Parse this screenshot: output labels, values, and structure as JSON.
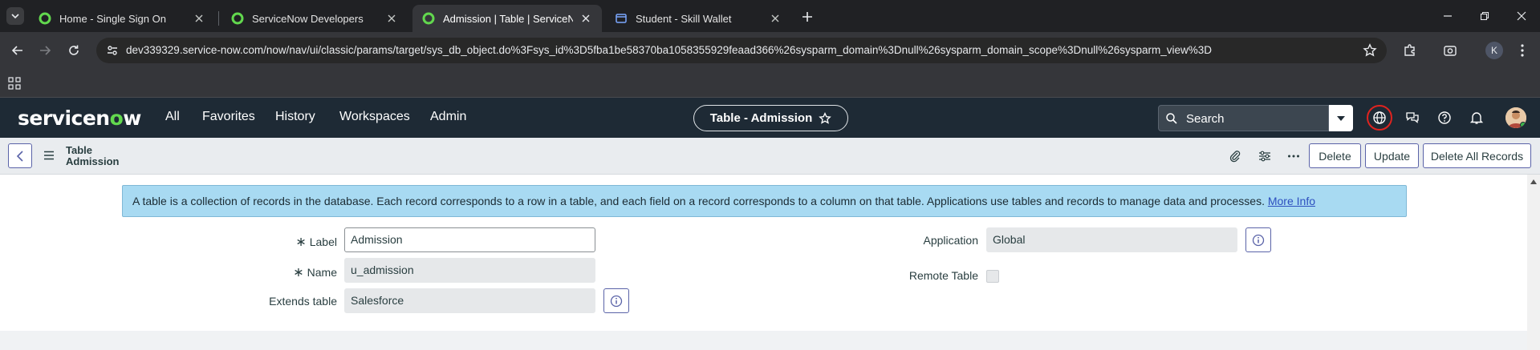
{
  "browser": {
    "tabs": [
      {
        "title": "Home - Single Sign On",
        "active": false
      },
      {
        "title": "ServiceNow Developers",
        "active": false
      },
      {
        "title": "Admission | Table | ServiceNow",
        "active": true
      },
      {
        "title": "Student - Skill Wallet",
        "active": false
      }
    ],
    "url": "dev339329.service-now.com/now/nav/ui/classic/params/target/sys_db_object.do%3Fsys_id%3D5fba1be58370ba1058355929feaad366%26sysparm_domain%3Dnull%26sysparm_domain_scope%3Dnull%26sysparm_view%3D",
    "profile_initial": "K"
  },
  "sn": {
    "logo": {
      "pre": "servicen",
      "o": "o",
      "post": "w"
    },
    "nav": [
      "All",
      "Favorites",
      "History",
      "Workspaces",
      "Admin"
    ],
    "context_title": "Table - Admission",
    "search_placeholder": "Search"
  },
  "form_header": {
    "line1": "Table",
    "line2": "Admission",
    "buttons": {
      "delete": "Delete",
      "update": "Update",
      "delete_all": "Delete All Records"
    }
  },
  "form": {
    "info_text": "A table is a collection of records in the database. Each record corresponds to a row in a table, and each field on a record corresponds to a column on that table. Applications use tables and records to manage data and processes.",
    "info_link": "More Info",
    "fields": {
      "label": {
        "label": "Label",
        "value": "Admission",
        "required": true
      },
      "name": {
        "label": "Name",
        "value": "u_admission",
        "required": true
      },
      "extends": {
        "label": "Extends table",
        "value": "Salesforce"
      },
      "application": {
        "label": "Application",
        "value": "Global"
      },
      "remote": {
        "label": "Remote Table",
        "checked": false
      }
    },
    "required_mark": "∗"
  },
  "colors": {
    "sn_header": "#1e2a35",
    "accent_green": "#62d84e",
    "info_bg": "#a8daf2",
    "button_border": "#5a63a8"
  }
}
